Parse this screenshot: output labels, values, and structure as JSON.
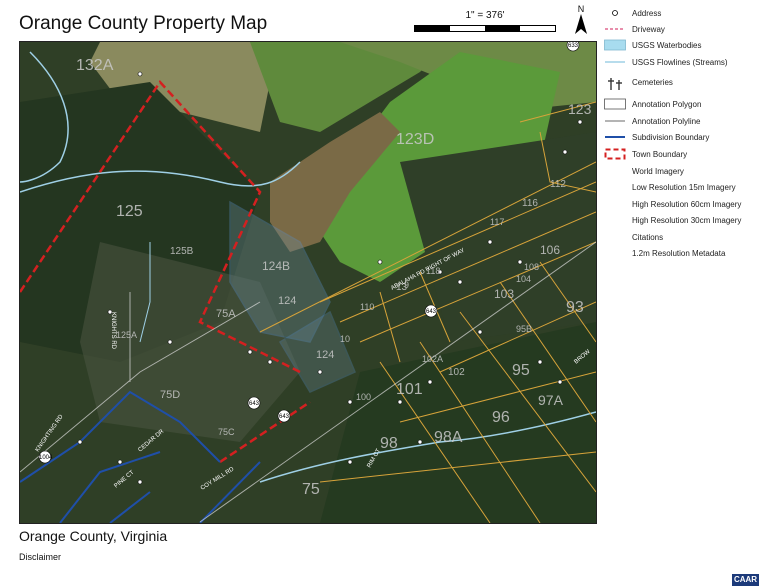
{
  "title": "Orange County Property Map",
  "scale": {
    "label": "1\" = 376'"
  },
  "north_arrow": {
    "label": "N"
  },
  "subtitle": "Orange County, Virginia",
  "disclaimer": "Disclaimer",
  "badge": "CAAR",
  "legend": [
    {
      "label": "Address",
      "symbol": "address-dot-icon"
    },
    {
      "label": "Driveway",
      "symbol": "driveway-line",
      "color": "#d94a7a"
    },
    {
      "label": "USGS Waterbodies",
      "symbol": "waterbody-fill",
      "color": "#a8dcef"
    },
    {
      "label": "USGS Flowlines (Streams)",
      "symbol": "flowline-line",
      "color": "#9fd0e6"
    },
    {
      "label": "Cemeteries",
      "symbol": "cemetery-icon"
    },
    {
      "label": "Annotation Polygon",
      "symbol": "annotation-polygon-box"
    },
    {
      "label": "Annotation Polyline",
      "symbol": "annotation-polyline-line"
    },
    {
      "label": "Subdivision Boundary",
      "symbol": "subdivision-line",
      "color": "#1f4fa8"
    },
    {
      "label": "Town Boundary",
      "symbol": "town-boundary-box",
      "color": "#d42020"
    },
    {
      "label": "World Imagery",
      "symbol": "none"
    },
    {
      "label": "Low Resolution 15m Imagery",
      "symbol": "none"
    },
    {
      "label": "High Resolution 60cm Imagery",
      "symbol": "none"
    },
    {
      "label": "High Resolution 30cm Imagery",
      "symbol": "none"
    },
    {
      "label": "Citations",
      "symbol": "none"
    },
    {
      "label": "1.2m Resolution Metadata",
      "symbol": "none"
    }
  ],
  "parcels": [
    "132A",
    "123D",
    "125",
    "125B",
    "124B",
    "124",
    "124",
    "75A",
    "75D",
    "75C",
    "75",
    "101",
    "102",
    "102A",
    "95",
    "95B",
    "96",
    "97A",
    "98",
    "98A",
    "93",
    "103",
    "106",
    "108",
    "104",
    "112",
    "116",
    "117",
    "118",
    "110",
    "123",
    "13",
    "100",
    "125A",
    "9",
    "10"
  ],
  "roads": [
    "ABALAHA RD RIGHT OF WAY",
    "KNIGHTS RD",
    "KNIGHTING RD",
    "CEDAR DR",
    "PINE CT",
    "COY MILL RD",
    "RIM CT",
    "BROW",
    "643",
    "643",
    "643",
    "633",
    "1004"
  ],
  "colors": {
    "parcel_line": "#d6a33a",
    "town_boundary": "#d42020",
    "subdivision": "#1f4fa8",
    "stream": "#9fd0e6",
    "selected_parcel": "#5b8fc8"
  }
}
